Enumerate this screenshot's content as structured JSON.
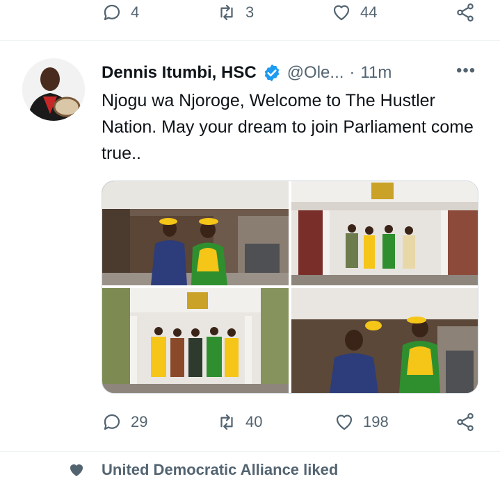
{
  "previous_tweet": {
    "actions": {
      "reply_count": "4",
      "retweet_count": "3",
      "like_count": "44"
    }
  },
  "tweet": {
    "author_name": "Dennis Itumbi, HSC",
    "handle": "@Ole...",
    "separator": "·",
    "time": "11m",
    "more": "•••",
    "text": "Njogu wa Njoroge, Welcome to The Hustler Nation. May your dream to join Parliament come true..",
    "actions": {
      "reply_count": "29",
      "retweet_count": "40",
      "like_count": "198"
    }
  },
  "liked_notice": {
    "text": "United Democratic Alliance liked"
  },
  "colors": {
    "muted": "#536471",
    "verified": "#1d9bf0",
    "divider": "#eff3f4",
    "shirt_yellow": "#f5c518",
    "shirt_green": "#2f8f2f"
  },
  "icons": [
    "reply-icon",
    "retweet-icon",
    "like-icon",
    "share-icon",
    "verified-icon",
    "more-icon",
    "heart-icon"
  ]
}
